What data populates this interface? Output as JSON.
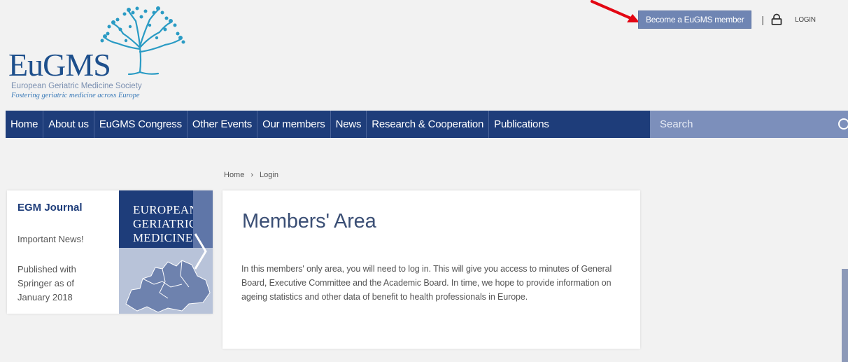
{
  "logo": {
    "name": "EuGMS",
    "subtitle": "European Geriatric Medicine Society",
    "tagline": "Fostering geriatric medicine across Europe"
  },
  "topbar": {
    "member_button": "Become a EuGMS member",
    "divider": "|",
    "login": "LOGIN",
    "icons": {
      "lock": "lock-icon",
      "arrow": "red-arrow-annotation"
    }
  },
  "nav": {
    "items": [
      {
        "label": "Home"
      },
      {
        "label": "About us"
      },
      {
        "label": "EuGMS Congress"
      },
      {
        "label": "Other Events"
      },
      {
        "label": "Our members"
      },
      {
        "label": "News"
      },
      {
        "label": "Research & Cooperation"
      },
      {
        "label": "Publications"
      }
    ],
    "search_placeholder": "Search"
  },
  "breadcrumb": {
    "home": "Home",
    "separator": "›",
    "current": "Login"
  },
  "sidebar": {
    "title": "EGM Journal",
    "news": "Important News!",
    "published": "Published with Springer as of January 2018",
    "cover_text": [
      "EUROPEAN",
      "GERIATRIC",
      "MEDICINE"
    ]
  },
  "main": {
    "title": "Members' Area",
    "body": "In this members' only area, you will need to log in. This will give you access to minutes of General Board, Executive Committee and the Academic Board. In time, we hope to provide information on ageing statistics and other data of benefit to health professionals in Europe."
  },
  "colors": {
    "nav_bg": "#1e3d7a",
    "search_bg": "#7c8fbb",
    "member_button_bg": "#6f85b3",
    "title_blue": "#1d4f8c",
    "teal": "#2a9bc4",
    "annotation_red": "#e30613"
  }
}
